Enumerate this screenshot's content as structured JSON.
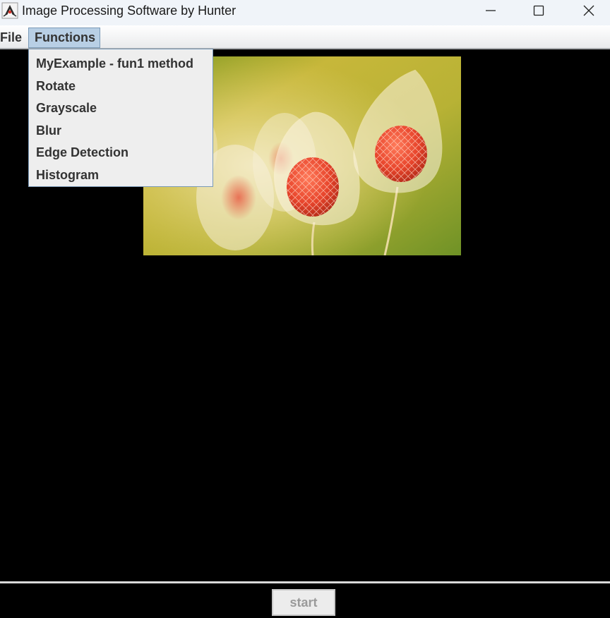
{
  "window": {
    "title": "Image Processing Software by Hunter"
  },
  "menubar": {
    "items": [
      {
        "label": "File"
      },
      {
        "label": "Functions"
      }
    ]
  },
  "functions_menu": {
    "items": [
      {
        "label": "MyExample - fun1 method"
      },
      {
        "label": "Rotate"
      },
      {
        "label": "Grayscale"
      },
      {
        "label": "Blur"
      },
      {
        "label": "Edge Detection"
      },
      {
        "label": "Histogram"
      }
    ]
  },
  "footer": {
    "start_label": "start"
  },
  "colors": {
    "titlebar_bg": "#f0f4f9",
    "menu_selected_bg": "#b8cfe5",
    "canvas_bg": "#000000",
    "dropdown_bg": "#eeeeee"
  },
  "icons": {
    "app": "java-duke-icon",
    "minimize": "minimize-icon",
    "maximize": "maximize-icon",
    "close": "close-icon"
  }
}
